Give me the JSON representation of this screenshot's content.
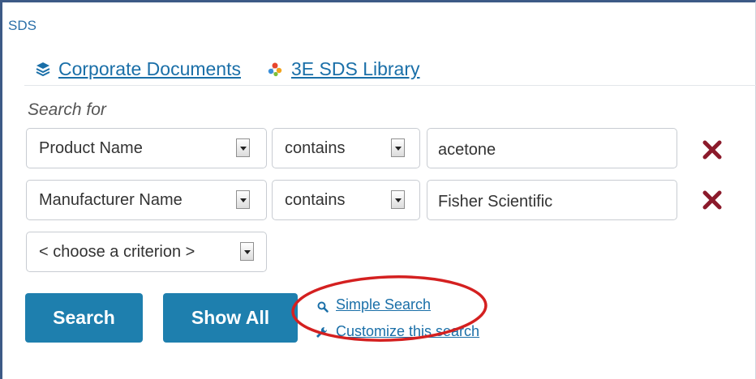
{
  "header": {
    "section_label": "SDS"
  },
  "tabs": [
    {
      "label": "Corporate Documents",
      "icon": "layers-icon"
    },
    {
      "label": "3E SDS Library",
      "icon": "molecule-icon"
    }
  ],
  "search": {
    "heading": "Search for",
    "criteria": [
      {
        "field": "Product Name",
        "operator": "contains",
        "value": "acetone"
      },
      {
        "field": "Manufacturer Name",
        "operator": "contains",
        "value": "Fisher Scientific"
      }
    ],
    "add_criterion_placeholder": "< choose a criterion >"
  },
  "actions": {
    "search_label": "Search",
    "show_all_label": "Show All",
    "simple_search_label": "Simple Search",
    "customize_label": "Customize this search"
  },
  "colors": {
    "accent": "#1e7fae",
    "link": "#1a6fa8",
    "remove": "#8b1a2b",
    "annotation": "#d42020",
    "frame": "#3d5a86"
  }
}
